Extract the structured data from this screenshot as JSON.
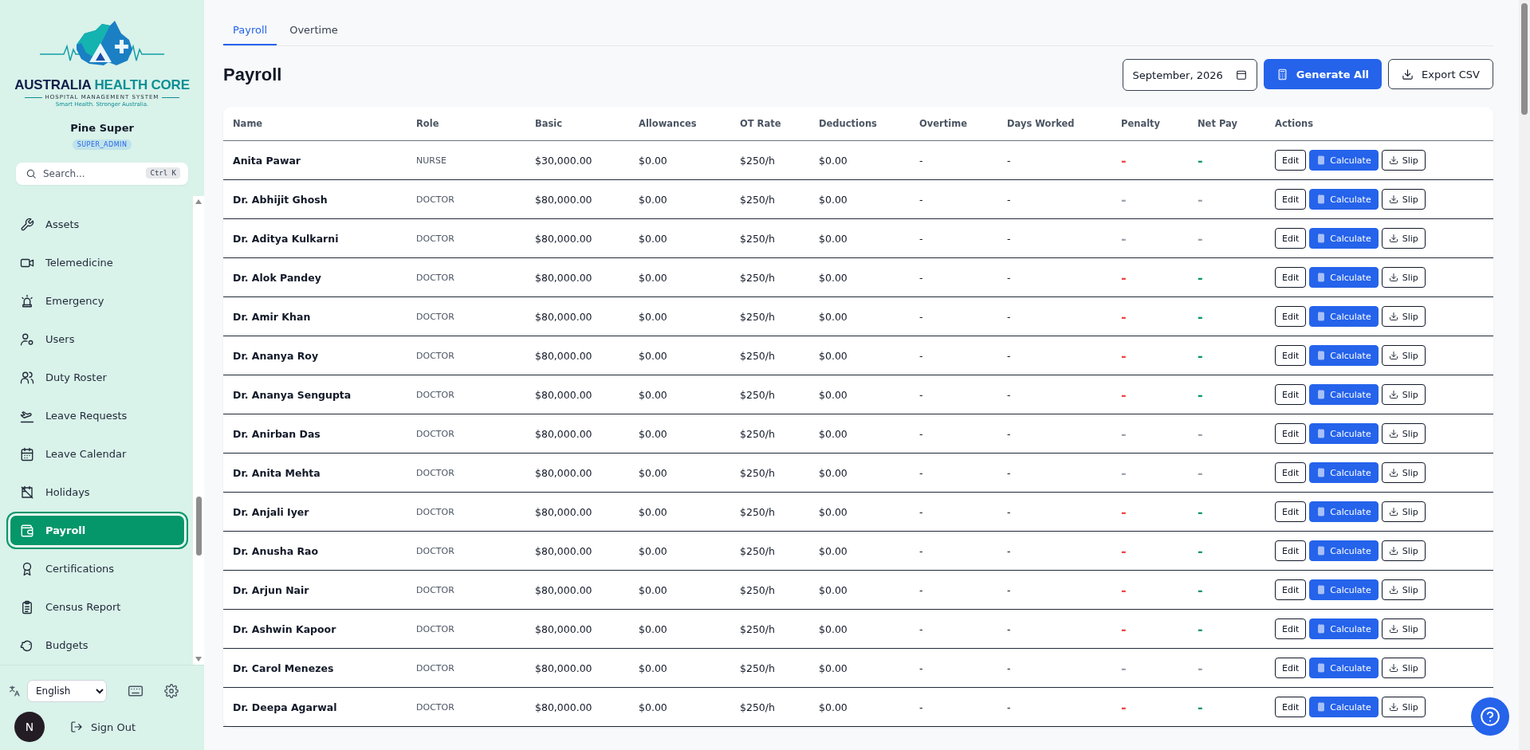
{
  "sidebar": {
    "logo": {
      "brand": "AUSTRALIA",
      "brand_accent": "HEALTH CORE",
      "subtitle": "HOSPITAL MANAGEMENT SYSTEM",
      "tagline": "Smart Health. Stronger Australia."
    },
    "user": {
      "name": "Pine Super",
      "role": "SUPER_ADMIN",
      "avatar": "N"
    },
    "search": {
      "placeholder": "Search...",
      "shortcut": "Ctrl K"
    },
    "items": [
      {
        "label": "Assets",
        "selected": false
      },
      {
        "label": "Telemedicine",
        "selected": false
      },
      {
        "label": "Emergency",
        "selected": false
      },
      {
        "label": "Users",
        "selected": false
      },
      {
        "label": "Duty Roster",
        "selected": false
      },
      {
        "label": "Leave Requests",
        "selected": false
      },
      {
        "label": "Leave Calendar",
        "selected": false
      },
      {
        "label": "Holidays",
        "selected": false
      },
      {
        "label": "Payroll",
        "selected": true
      },
      {
        "label": "Certifications",
        "selected": false
      },
      {
        "label": "Census Report",
        "selected": false
      },
      {
        "label": "Budgets",
        "selected": false
      }
    ],
    "language": "English",
    "sign_out": "Sign Out"
  },
  "tabs": [
    {
      "label": "Payroll",
      "selected": true
    },
    {
      "label": "Overtime",
      "selected": false
    }
  ],
  "page_title": "Payroll",
  "month": "September, 2026",
  "buttons": {
    "generate": "Generate All",
    "export": "Export CSV"
  },
  "table": {
    "columns": [
      "Name",
      "Role",
      "Basic",
      "Allowances",
      "OT Rate",
      "Deductions",
      "Overtime",
      "Days Worked",
      "Penalty",
      "Net Pay",
      "Actions"
    ],
    "rows": [
      {
        "name": "Anita Pawar",
        "role": "NURSE",
        "basic": "$30,000.00",
        "allowances": "$0.00",
        "ot_rate": "$250/h",
        "deductions": "$0.00",
        "overtime": "-",
        "days_worked": "-",
        "penalty": {
          "text": "-",
          "color": "#ef4444"
        },
        "net_pay": {
          "text": "-",
          "color": "#059669"
        },
        "actions": [
          "Edit",
          "Calculate",
          "Slip"
        ]
      },
      {
        "name": "Dr. Abhijit Ghosh",
        "role": "DOCTOR",
        "basic": "$80,000.00",
        "allowances": "$0.00",
        "ot_rate": "$250/h",
        "deductions": "$0.00",
        "overtime": "-",
        "days_worked": "-",
        "penalty": {
          "text": "-",
          "color": "#9ca3af"
        },
        "net_pay": {
          "text": "-",
          "color": "#9ca3af"
        },
        "actions": [
          "Edit",
          "Calculate",
          "Slip"
        ]
      },
      {
        "name": "Dr. Aditya Kulkarni",
        "role": "DOCTOR",
        "basic": "$80,000.00",
        "allowances": "$0.00",
        "ot_rate": "$250/h",
        "deductions": "$0.00",
        "overtime": "-",
        "days_worked": "-",
        "penalty": {
          "text": "-",
          "color": "#9ca3af"
        },
        "net_pay": {
          "text": "-",
          "color": "#9ca3af"
        },
        "actions": [
          "Edit",
          "Calculate",
          "Slip"
        ]
      },
      {
        "name": "Dr. Alok Pandey",
        "role": "DOCTOR",
        "basic": "$80,000.00",
        "allowances": "$0.00",
        "ot_rate": "$250/h",
        "deductions": "$0.00",
        "overtime": "-",
        "days_worked": "-",
        "penalty": {
          "text": "-",
          "color": "#ef4444"
        },
        "net_pay": {
          "text": "-",
          "color": "#059669"
        },
        "actions": [
          "Edit",
          "Calculate",
          "Slip"
        ]
      },
      {
        "name": "Dr. Amir Khan",
        "role": "DOCTOR",
        "basic": "$80,000.00",
        "allowances": "$0.00",
        "ot_rate": "$250/h",
        "deductions": "$0.00",
        "overtime": "-",
        "days_worked": "-",
        "penalty": {
          "text": "-",
          "color": "#ef4444"
        },
        "net_pay": {
          "text": "-",
          "color": "#059669"
        },
        "actions": [
          "Edit",
          "Calculate",
          "Slip"
        ]
      },
      {
        "name": "Dr. Ananya Roy",
        "role": "DOCTOR",
        "basic": "$80,000.00",
        "allowances": "$0.00",
        "ot_rate": "$250/h",
        "deductions": "$0.00",
        "overtime": "-",
        "days_worked": "-",
        "penalty": {
          "text": "-",
          "color": "#ef4444"
        },
        "net_pay": {
          "text": "-",
          "color": "#059669"
        },
        "actions": [
          "Edit",
          "Calculate",
          "Slip"
        ]
      },
      {
        "name": "Dr. Ananya Sengupta",
        "role": "DOCTOR",
        "basic": "$80,000.00",
        "allowances": "$0.00",
        "ot_rate": "$250/h",
        "deductions": "$0.00",
        "overtime": "-",
        "days_worked": "-",
        "penalty": {
          "text": "-",
          "color": "#ef4444"
        },
        "net_pay": {
          "text": "-",
          "color": "#059669"
        },
        "actions": [
          "Edit",
          "Calculate",
          "Slip"
        ]
      },
      {
        "name": "Dr. Anirban Das",
        "role": "DOCTOR",
        "basic": "$80,000.00",
        "allowances": "$0.00",
        "ot_rate": "$250/h",
        "deductions": "$0.00",
        "overtime": "-",
        "days_worked": "-",
        "penalty": {
          "text": "-",
          "color": "#9ca3af"
        },
        "net_pay": {
          "text": "-",
          "color": "#9ca3af"
        },
        "actions": [
          "Edit",
          "Calculate",
          "Slip"
        ]
      },
      {
        "name": "Dr. Anita Mehta",
        "role": "DOCTOR",
        "basic": "$80,000.00",
        "allowances": "$0.00",
        "ot_rate": "$250/h",
        "deductions": "$0.00",
        "overtime": "-",
        "days_worked": "-",
        "penalty": {
          "text": "-",
          "color": "#9ca3af"
        },
        "net_pay": {
          "text": "-",
          "color": "#9ca3af"
        },
        "actions": [
          "Edit",
          "Calculate",
          "Slip"
        ]
      },
      {
        "name": "Dr. Anjali Iyer",
        "role": "DOCTOR",
        "basic": "$80,000.00",
        "allowances": "$0.00",
        "ot_rate": "$250/h",
        "deductions": "$0.00",
        "overtime": "-",
        "days_worked": "-",
        "penalty": {
          "text": "-",
          "color": "#ef4444"
        },
        "net_pay": {
          "text": "-",
          "color": "#059669"
        },
        "actions": [
          "Edit",
          "Calculate",
          "Slip"
        ]
      },
      {
        "name": "Dr. Anusha Rao",
        "role": "DOCTOR",
        "basic": "$80,000.00",
        "allowances": "$0.00",
        "ot_rate": "$250/h",
        "deductions": "$0.00",
        "overtime": "-",
        "days_worked": "-",
        "penalty": {
          "text": "-",
          "color": "#ef4444"
        },
        "net_pay": {
          "text": "-",
          "color": "#059669"
        },
        "actions": [
          "Edit",
          "Calculate",
          "Slip"
        ]
      },
      {
        "name": "Dr. Arjun Nair",
        "role": "DOCTOR",
        "basic": "$80,000.00",
        "allowances": "$0.00",
        "ot_rate": "$250/h",
        "deductions": "$0.00",
        "overtime": "-",
        "days_worked": "-",
        "penalty": {
          "text": "-",
          "color": "#ef4444"
        },
        "net_pay": {
          "text": "-",
          "color": "#059669"
        },
        "actions": [
          "Edit",
          "Calculate",
          "Slip"
        ]
      },
      {
        "name": "Dr. Ashwin Kapoor",
        "role": "DOCTOR",
        "basic": "$80,000.00",
        "allowances": "$0.00",
        "ot_rate": "$250/h",
        "deductions": "$0.00",
        "overtime": "-",
        "days_worked": "-",
        "penalty": {
          "text": "-",
          "color": "#ef4444"
        },
        "net_pay": {
          "text": "-",
          "color": "#059669"
        },
        "actions": [
          "Edit",
          "Calculate",
          "Slip"
        ]
      },
      {
        "name": "Dr. Carol Menezes",
        "role": "DOCTOR",
        "basic": "$80,000.00",
        "allowances": "$0.00",
        "ot_rate": "$250/h",
        "deductions": "$0.00",
        "overtime": "-",
        "days_worked": "-",
        "penalty": {
          "text": "-",
          "color": "#9ca3af"
        },
        "net_pay": {
          "text": "-",
          "color": "#9ca3af"
        },
        "actions": [
          "Edit",
          "Calculate",
          "Slip"
        ]
      },
      {
        "name": "Dr. Deepa Agarwal",
        "role": "DOCTOR",
        "basic": "$80,000.00",
        "allowances": "$0.00",
        "ot_rate": "$250/h",
        "deductions": "$0.00",
        "overtime": "-",
        "days_worked": "-",
        "penalty": {
          "text": "-",
          "color": "#ef4444"
        },
        "net_pay": {
          "text": "-",
          "color": "#059669"
        },
        "actions": [
          "Edit",
          "Calculate",
          "Slip"
        ]
      }
    ]
  }
}
